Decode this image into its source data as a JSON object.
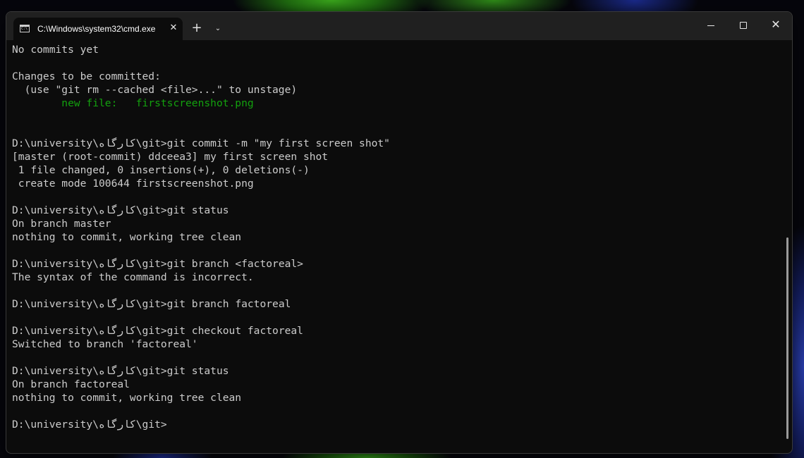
{
  "window": {
    "tab_title": "C:\\Windows\\system32\\cmd.exe",
    "tab_icon": "cmd-icon",
    "tab_icon_text": "C:\\",
    "close_tab_label": "✕",
    "new_tab_label": "+",
    "dropdown_label": "⌄",
    "close_label": "✕"
  },
  "terminal": {
    "lines": [
      "No commits yet",
      "",
      "Changes to be committed:",
      "  (use \"git rm --cached <file>...\" to unstage)",
      "        new file:   firstscreenshot.png",
      "",
      "",
      "D:\\university\\کارگاه\\git>git commit -m \"my first screen shot\"",
      "[master (root-commit) ddceea3] my first screen shot",
      " 1 file changed, 0 insertions(+), 0 deletions(-)",
      " create mode 100644 firstscreenshot.png",
      "",
      "D:\\university\\کارگاه\\git>git status",
      "On branch master",
      "nothing to commit, working tree clean",
      "",
      "D:\\university\\کارگاه\\git>git branch <factoreal>",
      "The syntax of the command is incorrect.",
      "",
      "D:\\university\\کارگاه\\git>git branch factoreal",
      "",
      "D:\\university\\کارگاه\\git>git checkout factoreal",
      "Switched to branch 'factoreal'",
      "",
      "D:\\university\\کارگاه\\git>git status",
      "On branch factoreal",
      "nothing to commit, working tree clean",
      "",
      "D:\\university\\کارگاه\\git>"
    ],
    "highlight_line_index": 4,
    "text_color": "#cccccc",
    "highlight_color": "#13a10e",
    "background_color": "#0c0c0c"
  }
}
